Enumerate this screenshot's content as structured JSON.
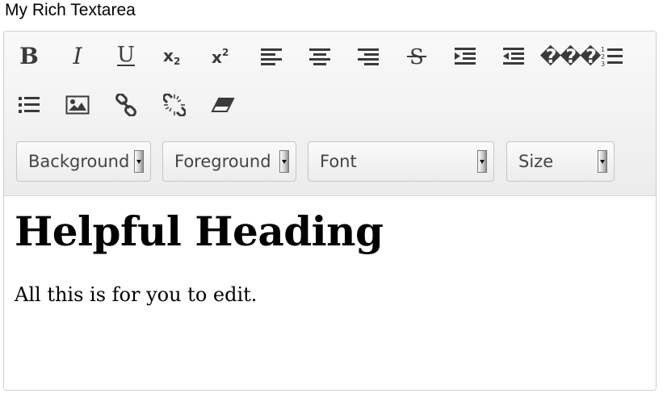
{
  "label": "My Rich Textarea",
  "toolbar": {
    "buttons": [
      {
        "name": "bold-button",
        "icon": "bold-icon"
      },
      {
        "name": "italic-button",
        "icon": "italic-icon"
      },
      {
        "name": "underline-button",
        "icon": "underline-icon"
      },
      {
        "name": "subscript-button",
        "icon": "subscript-icon"
      },
      {
        "name": "superscript-button",
        "icon": "superscript-icon"
      },
      {
        "name": "align-left-button",
        "icon": "align-left-icon"
      },
      {
        "name": "align-center-button",
        "icon": "align-center-icon"
      },
      {
        "name": "align-right-button",
        "icon": "align-right-icon"
      },
      {
        "name": "strikethrough-button",
        "icon": "strikethrough-icon"
      },
      {
        "name": "indent-button",
        "icon": "indent-icon"
      },
      {
        "name": "outdent-button",
        "icon": "outdent-icon"
      },
      {
        "name": "ordered-list-button",
        "icon": "ordered-list-icon",
        "broken_glyph_text": "���"
      },
      {
        "name": "unordered-list-button",
        "icon": "unordered-list-icon"
      },
      {
        "name": "insert-image-button",
        "icon": "image-icon"
      },
      {
        "name": "insert-link-button",
        "icon": "link-icon"
      },
      {
        "name": "remove-link-button",
        "icon": "unlink-icon"
      },
      {
        "name": "clear-formatting-button",
        "icon": "eraser-icon"
      }
    ],
    "selects": {
      "background": "Background",
      "foreground": "Foreground",
      "font": "Font",
      "size": "Size"
    }
  },
  "content": {
    "heading": "Helpful Heading",
    "paragraph": "All this is for you to edit."
  },
  "colors": {
    "icon": "#3a3a3a",
    "toolbar_bg": "#f3f3f3",
    "border": "#cfcfcf"
  }
}
